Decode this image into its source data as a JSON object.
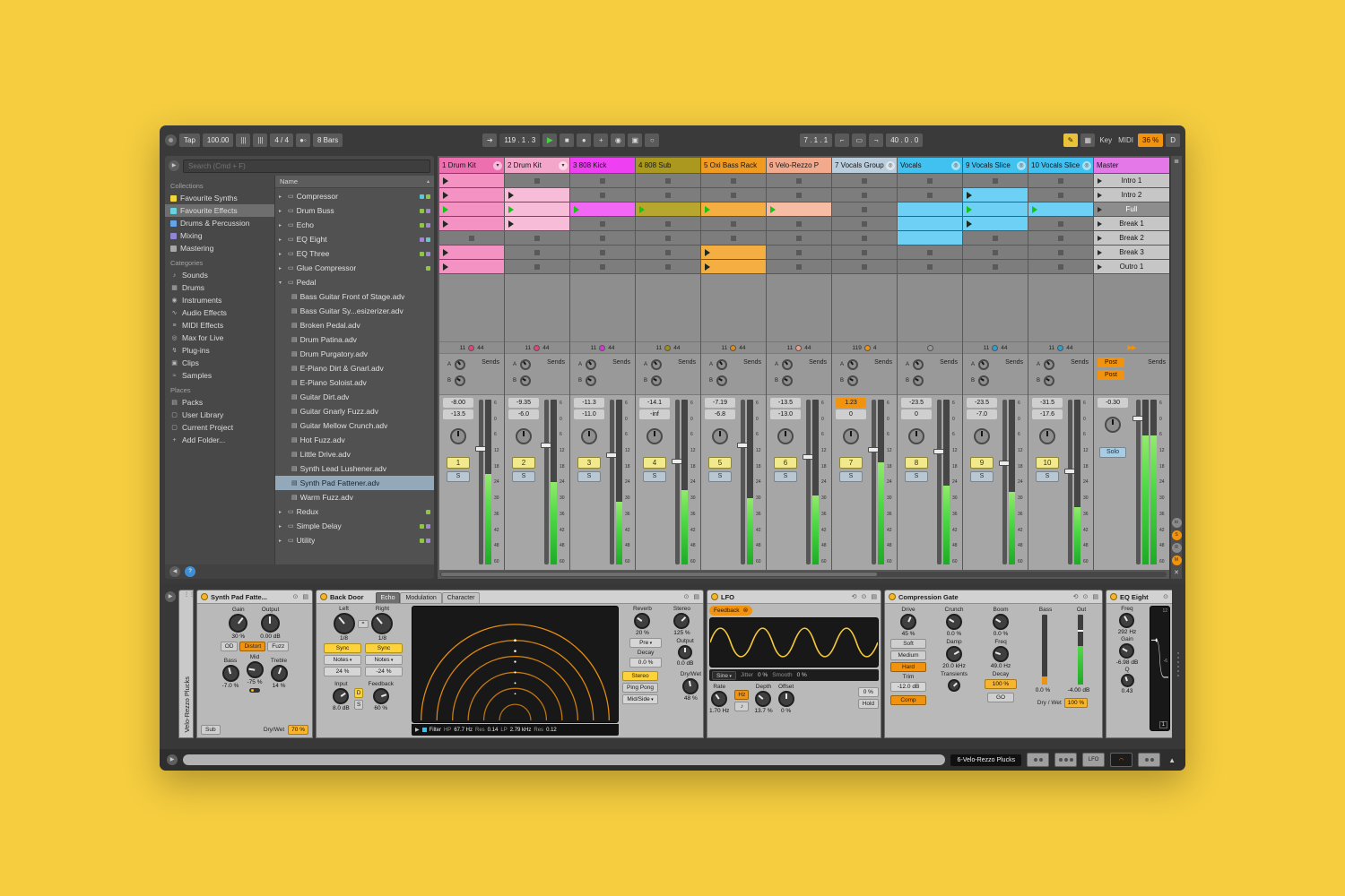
{
  "transport": {
    "tap": "Tap",
    "tempo": "100.00",
    "nudge": "|||",
    "time_sig": "4 / 4",
    "metronome": "●◦",
    "quantize": "8 Bars",
    "position": "119 . 1 . 3",
    "loop_start": "7 . 1 . 1",
    "loop_length": "40 . 0 . 0",
    "key_label": "Key",
    "midi_label": "MIDI",
    "cpu": "36 %",
    "disk": "D"
  },
  "browser": {
    "search_placeholder": "Search (Cmd + F)",
    "sections": [
      {
        "title": "Collections",
        "items": [
          {
            "label": "Favourite Synths",
            "swatch": "#f5d638"
          },
          {
            "label": "Favourite Effects",
            "swatch": "#66d3df",
            "selected": true
          },
          {
            "label": "Drums & Percussion",
            "swatch": "#64a4e8"
          },
          {
            "label": "Mixing",
            "swatch": "#8f86d4"
          },
          {
            "label": "Mastering",
            "swatch": "#a8a8a8"
          }
        ]
      },
      {
        "title": "Categories",
        "items": [
          {
            "label": "Sounds",
            "icon": "sounds"
          },
          {
            "label": "Drums",
            "icon": "drums"
          },
          {
            "label": "Instruments",
            "icon": "instruments"
          },
          {
            "label": "Audio Effects",
            "icon": "audio-effects"
          },
          {
            "label": "MIDI Effects",
            "icon": "midi-effects"
          },
          {
            "label": "Max for Live",
            "icon": "max-for-live"
          },
          {
            "label": "Plug-ins",
            "icon": "plugins"
          },
          {
            "label": "Clips",
            "icon": "clips"
          },
          {
            "label": "Samples",
            "icon": "samples"
          }
        ]
      },
      {
        "title": "Places",
        "items": [
          {
            "label": "Packs",
            "icon": "packs"
          },
          {
            "label": "User Library",
            "icon": "folder"
          },
          {
            "label": "Current Project",
            "icon": "folder"
          },
          {
            "label": "Add Folder...",
            "icon": "add-folder"
          }
        ]
      }
    ],
    "tree_header": "Name",
    "tree": [
      {
        "label": "Compressor",
        "kind": "device",
        "tags": [
          "#5fc8d4",
          "#8dc83f"
        ]
      },
      {
        "label": "Drum Buss",
        "kind": "device",
        "tags": [
          "#8dc83f",
          "#a284d8"
        ]
      },
      {
        "label": "Echo",
        "kind": "device",
        "tags": [
          "#8dc83f",
          "#a284d8"
        ]
      },
      {
        "label": "EQ Eight",
        "kind": "device",
        "tags": [
          "#a284d8",
          "#5fc8d4"
        ]
      },
      {
        "label": "EQ Three",
        "kind": "device",
        "tags": [
          "#8dc83f",
          "#a284d8"
        ]
      },
      {
        "label": "Glue Compressor",
        "kind": "device",
        "tags": [
          "#8dc83f"
        ]
      },
      {
        "label": "Pedal",
        "kind": "device",
        "expanded": true,
        "tags": []
      },
      {
        "label": "Bass Guitar Front of Stage.adv",
        "kind": "preset"
      },
      {
        "label": "Bass Guitar Sy...esizerizer.adv",
        "kind": "preset"
      },
      {
        "label": "Broken Pedal.adv",
        "kind": "preset"
      },
      {
        "label": "Drum Patina.adv",
        "kind": "preset"
      },
      {
        "label": "Drum Purgatory.adv",
        "kind": "preset"
      },
      {
        "label": "E-Piano Dirt & Gnarl.adv",
        "kind": "preset"
      },
      {
        "label": "E-Piano Soloist.adv",
        "kind": "preset"
      },
      {
        "label": "Guitar Dirt.adv",
        "kind": "preset"
      },
      {
        "label": "Guitar Gnarly Fuzz.adv",
        "kind": "preset"
      },
      {
        "label": "Guitar Mellow Crunch.adv",
        "kind": "preset"
      },
      {
        "label": "Hot Fuzz.adv",
        "kind": "preset"
      },
      {
        "label": "Little Drive.adv",
        "kind": "preset"
      },
      {
        "label": "Synth Lead Lushener.adv",
        "kind": "preset"
      },
      {
        "label": "Synth Pad Fattener.adv",
        "kind": "preset",
        "selected": true
      },
      {
        "label": "Warm Fuzz.adv",
        "kind": "preset"
      },
      {
        "label": "Redux",
        "kind": "device",
        "tags": [
          "#8dc83f"
        ]
      },
      {
        "label": "Simple Delay",
        "kind": "device",
        "tags": [
          "#8dc83f",
          "#a284d8"
        ]
      },
      {
        "label": "Utility",
        "kind": "device",
        "tags": [
          "#8dc83f",
          "#a284d8"
        ]
      }
    ]
  },
  "session": {
    "scenes": [
      {
        "label": "Intro 1"
      },
      {
        "label": "Intro 2"
      },
      {
        "label": "Full",
        "selected": true
      },
      {
        "label": "Break 1"
      },
      {
        "label": "Break 2"
      },
      {
        "label": "Break 3"
      },
      {
        "label": "Outro 1"
      }
    ],
    "master": {
      "label": "Master",
      "hcolor": "#e478e8",
      "vol": "-0.30",
      "meter": 0.78,
      "fader": 0.1
    },
    "tracks": [
      {
        "name": "1 Drum Kit",
        "menu": "chevron",
        "hcolor": "#ee6fb0",
        "ccolor": "#f392c3",
        "clips": [
          "c",
          "c",
          "p",
          "c",
          "s",
          "c",
          "c"
        ],
        "io": {
          "l": "11",
          "r": "44",
          "dot": "#e2447e"
        },
        "peak": "-8.00",
        "vol": "-13.5",
        "num": "1",
        "meter": 0.55,
        "fader": 0.28
      },
      {
        "name": "2 Drum Kit",
        "menu": "chevron",
        "hcolor": "#f4a6ca",
        "ccolor": "#f7bcd8",
        "clips": [
          "s",
          "c",
          "p",
          "c",
          "s",
          "s",
          "s"
        ],
        "io": {
          "l": "11",
          "r": "44",
          "dot": "#e2447e"
        },
        "peak": "-9.35",
        "vol": "-6.0",
        "num": "2",
        "meter": 0.5,
        "fader": 0.26
      },
      {
        "name": "3 808 Kick",
        "hcolor": "#ee40f2",
        "ccolor": "#f268f4",
        "clips": [
          "s",
          "s",
          "p",
          "s",
          "s",
          "s",
          "s"
        ],
        "io": {
          "l": "11",
          "r": "44",
          "dot": "#d438d8"
        },
        "peak": "-11.3",
        "vol": "-11.0",
        "num": "3",
        "meter": 0.38,
        "fader": 0.32
      },
      {
        "name": "4 808 Sub",
        "hcolor": "#aa991e",
        "ccolor": "#b8a72e",
        "clips": [
          "s",
          "s",
          "p",
          "s",
          "s",
          "s",
          "s"
        ],
        "io": {
          "l": "11",
          "r": "44",
          "dot": "#a08f1a"
        },
        "peak": "-14.1",
        "vol": "-inf",
        "num": "4",
        "meter": 0.45,
        "fader": 0.36
      },
      {
        "name": "5 Oxi Bass Rack",
        "hcolor": "#f19a20",
        "ccolor": "#f5ae42",
        "clips": [
          "s",
          "s",
          "p",
          "s",
          "s",
          "c",
          "c"
        ],
        "io": {
          "l": "11",
          "r": "44",
          "dot": "#e08a18"
        },
        "peak": "-7.19",
        "vol": "-6.8",
        "num": "5",
        "meter": 0.4,
        "fader": 0.26
      },
      {
        "name": "6 Velo-Rezzo P",
        "hcolor": "#f3a98b",
        "ccolor": "#f6bda4",
        "clips": [
          "s",
          "s",
          "p",
          "s",
          "s",
          "s",
          "s"
        ],
        "io": {
          "l": "11",
          "r": "44",
          "dot": "#e8a48a"
        },
        "peak": "-13.5",
        "vol": "-13.0",
        "num": "6",
        "meter": 0.42,
        "fader": 0.33
      },
      {
        "name": "7 Vocals Group",
        "menu": "group",
        "hcolor": "#b9cddc",
        "ccolor": "#c6d7e3",
        "clips": [
          "s",
          "s",
          "s",
          "s",
          "s",
          "s",
          "s"
        ],
        "io": {
          "l": "119",
          "r": "4",
          "dot": "#f2930f"
        },
        "peak": "1.23",
        "peak_hl": true,
        "vol": "0",
        "num": "7",
        "meter": 0.62,
        "fader": 0.29
      },
      {
        "name": "Vocals",
        "menu": "group",
        "hcolor": "#41c1f0",
        "ccolor": "#6fd0f5",
        "clips": [
          "s",
          "s",
          "h",
          "h",
          "h",
          "s",
          "s"
        ],
        "io": {
          "l": "",
          "r": "",
          "dot": "#9a9a9a"
        },
        "peak": "-23.5",
        "vol": "0",
        "num": "8",
        "meter": 0.48,
        "fader": 0.3
      },
      {
        "name": "9 Vocals Slice",
        "menu": "group",
        "hcolor": "#41c1f0",
        "ccolor": "#6fd0f5",
        "clips": [
          "s",
          "c",
          "p",
          "c",
          "s",
          "s",
          "s"
        ],
        "io": {
          "l": "11",
          "r": "44",
          "dot": "#2f9fd0"
        },
        "peak": "-23.5",
        "vol": "-7.0",
        "num": "9",
        "meter": 0.44,
        "fader": 0.37
      },
      {
        "name": "10 Vocals Slice",
        "menu": "group",
        "hcolor": "#41c1f0",
        "ccolor": "#6fd0f5",
        "clips": [
          "s",
          "s",
          "p",
          "s",
          "s",
          "s",
          "s"
        ],
        "io": {
          "l": "11",
          "r": "44",
          "dot": "#2f9fd0"
        },
        "peak": "-31.5",
        "vol": "-17.6",
        "num": "10",
        "meter": 0.35,
        "fader": 0.42
      }
    ]
  },
  "mixer": {
    "sends_label": "Sends",
    "send_a": "A",
    "send_b": "B",
    "post_a": "Post",
    "post_b": "Post",
    "solo_label": "Solo",
    "scale": [
      "6",
      "0",
      "6",
      "12",
      "18",
      "24",
      "30",
      "36",
      "42",
      "48",
      "60"
    ]
  },
  "right_strip": {
    "toggles": [
      {
        "label": "io",
        "on": false
      },
      {
        "label": "S",
        "on": true
      },
      {
        "label": "R",
        "on": false
      },
      {
        "label": "M",
        "on": true
      }
    ]
  },
  "devices": {
    "track_panel": {
      "title": "Velo-Rezzo Plucks"
    },
    "pedal": {
      "title": "Synth Pad Fatte...",
      "gain_label": "Gain",
      "gain": "30 %",
      "output_label": "Output",
      "output": "0.00 dB",
      "modes": [
        "OD",
        "Distort",
        "Fuzz"
      ],
      "bass_label": "Bass",
      "bass": "-7.0 %",
      "mid_label": "Mid",
      "mid": "-75 %",
      "treble_label": "Treble",
      "treble": "14 %",
      "sub_label": "Sub",
      "drywet_label": "Dry/Wet",
      "drywet": "70 %"
    },
    "echo": {
      "title": "Back Door",
      "tabs": [
        "Echo",
        "Modulation",
        "Character"
      ],
      "left_label": "Left",
      "right_label": "Right",
      "left_div": "1/8",
      "right_div": "1/8",
      "sync_label": "Sync",
      "notes_label": "Notes",
      "left_offset": "24 %",
      "right_offset": "-24 %",
      "input_label": "Input",
      "input": "8.0 dB",
      "d_label": "D",
      "s_label": "S",
      "feedback_label": "Feedback",
      "feedback": "60 %",
      "filter_label": "Filter",
      "hp_label": "HP",
      "hp": "67.7 Hz",
      "res1_label": "Res",
      "res1": "0.14",
      "lp_label": "LP",
      "lp": "2.79 kHz",
      "res2_label": "Res",
      "res2": "0.12",
      "reverb_label": "Reverb",
      "reverb": "20 %",
      "stereo_knob_label": "Stereo",
      "stereo_knob": "125 %",
      "pre_label": "Pre",
      "decay_label": "Decay",
      "decay": "0.0 %",
      "output_label": "Output",
      "output": "0.0 dB",
      "stereo_btn": "Stereo",
      "pingpong_btn": "Ping Pong",
      "midside_label": "Mid/Side",
      "drywet_label": "Dry/Wet",
      "drywet": "48 %"
    },
    "lfo": {
      "title": "LFO",
      "map_target": "Feedback",
      "shape": "Sine",
      "jitter_label": "Jitter",
      "jitter": "0 %",
      "smooth_label": "Smooth",
      "smooth": "0 %",
      "rate_label": "Rate",
      "rate": "1.70 Hz",
      "hz_label": "Hz",
      "depth_label": "Depth",
      "depth": "13.7 %",
      "offset_label": "Offset",
      "offset": "0 %",
      "phase": "0 %",
      "hold_label": "Hold"
    },
    "comp_gate": {
      "title": "Compression Gate",
      "drive_label": "Drive",
      "drive": "45 %",
      "crunch_label": "Crunch",
      "crunch": "0.0 %",
      "boom_label": "Boom",
      "boom": "0.0 %",
      "soft_label": "Soft",
      "medium_label": "Medium",
      "hard_label": "Hard",
      "damp_label": "Damp",
      "damp": "20.0 kHz",
      "freq_label": "Freq",
      "freq": "49.0 Hz",
      "trim_label": "Trim",
      "trim": "-12.0 dB",
      "transients_label": "Transients",
      "decay_label": "Decay",
      "decay": "100 %",
      "comp_label": "Comp",
      "go_label": "GO",
      "bass_label": "Bass",
      "out_label": "Out",
      "reduction": "0.0 %",
      "out_db": "-4.00 dB",
      "drywet_label": "Dry / Wet",
      "drywet": "100 %"
    },
    "eq8": {
      "title": "EQ Eight",
      "freq_label": "Freq",
      "freq": "292 Hz",
      "gain_label": "Gain",
      "gain": "-6.98 dB",
      "q_label": "Q",
      "q": "0.43",
      "scale_top": "12",
      "scale_mid": "-6",
      "band": "1"
    }
  },
  "statusbar": {
    "track_label": "6-Velo-Rezzo Plucks",
    "device_label": "LFO"
  }
}
